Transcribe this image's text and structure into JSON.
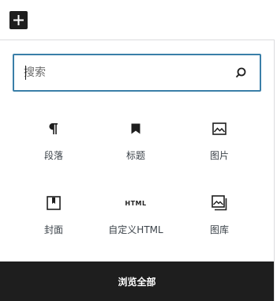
{
  "toolbar": {
    "inserter_icon": "plus-icon"
  },
  "search": {
    "placeholder": "搜索",
    "value": "",
    "icon": "search-icon"
  },
  "blocks": [
    {
      "label": "段落",
      "icon": "paragraph-icon"
    },
    {
      "label": "标题",
      "icon": "bookmark-heading-icon"
    },
    {
      "label": "图片",
      "icon": "image-icon"
    },
    {
      "label": "封面",
      "icon": "cover-icon"
    },
    {
      "label": "自定义HTML",
      "icon": "html-icon",
      "glyph": "HTML"
    },
    {
      "label": "图库",
      "icon": "gallery-icon"
    }
  ],
  "browse_all": {
    "label": "浏览全部"
  },
  "colors": {
    "accent": "#3a7fa8",
    "dark": "#1e1e1e"
  }
}
